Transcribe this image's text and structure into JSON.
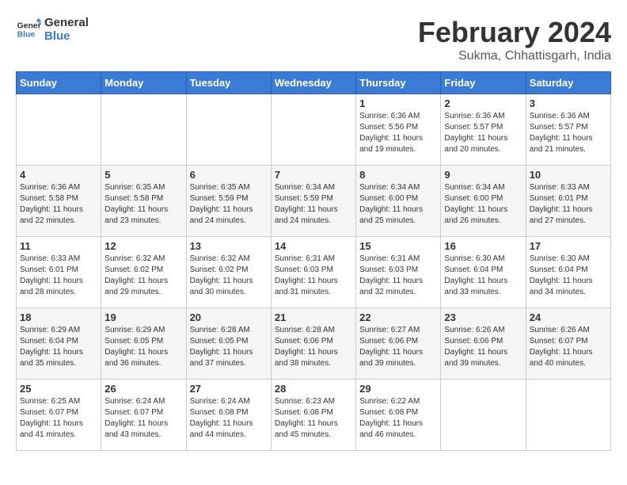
{
  "logo": {
    "line1": "General",
    "line2": "Blue"
  },
  "title": "February 2024",
  "subtitle": "Sukma, Chhattisgarh, India",
  "days_of_week": [
    "Sunday",
    "Monday",
    "Tuesday",
    "Wednesday",
    "Thursday",
    "Friday",
    "Saturday"
  ],
  "weeks": [
    [
      {
        "day": "",
        "info": ""
      },
      {
        "day": "",
        "info": ""
      },
      {
        "day": "",
        "info": ""
      },
      {
        "day": "",
        "info": ""
      },
      {
        "day": "1",
        "info": "Sunrise: 6:36 AM\nSunset: 5:56 PM\nDaylight: 11 hours\nand 19 minutes."
      },
      {
        "day": "2",
        "info": "Sunrise: 6:36 AM\nSunset: 5:57 PM\nDaylight: 11 hours\nand 20 minutes."
      },
      {
        "day": "3",
        "info": "Sunrise: 6:36 AM\nSunset: 5:57 PM\nDaylight: 11 hours\nand 21 minutes."
      }
    ],
    [
      {
        "day": "4",
        "info": "Sunrise: 6:36 AM\nSunset: 5:58 PM\nDaylight: 11 hours\nand 22 minutes."
      },
      {
        "day": "5",
        "info": "Sunrise: 6:35 AM\nSunset: 5:58 PM\nDaylight: 11 hours\nand 23 minutes."
      },
      {
        "day": "6",
        "info": "Sunrise: 6:35 AM\nSunset: 5:59 PM\nDaylight: 11 hours\nand 24 minutes."
      },
      {
        "day": "7",
        "info": "Sunrise: 6:34 AM\nSunset: 5:59 PM\nDaylight: 11 hours\nand 24 minutes."
      },
      {
        "day": "8",
        "info": "Sunrise: 6:34 AM\nSunset: 6:00 PM\nDaylight: 11 hours\nand 25 minutes."
      },
      {
        "day": "9",
        "info": "Sunrise: 6:34 AM\nSunset: 6:00 PM\nDaylight: 11 hours\nand 26 minutes."
      },
      {
        "day": "10",
        "info": "Sunrise: 6:33 AM\nSunset: 6:01 PM\nDaylight: 11 hours\nand 27 minutes."
      }
    ],
    [
      {
        "day": "11",
        "info": "Sunrise: 6:33 AM\nSunset: 6:01 PM\nDaylight: 11 hours\nand 28 minutes."
      },
      {
        "day": "12",
        "info": "Sunrise: 6:32 AM\nSunset: 6:02 PM\nDaylight: 11 hours\nand 29 minutes."
      },
      {
        "day": "13",
        "info": "Sunrise: 6:32 AM\nSunset: 6:02 PM\nDaylight: 11 hours\nand 30 minutes."
      },
      {
        "day": "14",
        "info": "Sunrise: 6:31 AM\nSunset: 6:03 PM\nDaylight: 11 hours\nand 31 minutes."
      },
      {
        "day": "15",
        "info": "Sunrise: 6:31 AM\nSunset: 6:03 PM\nDaylight: 11 hours\nand 32 minutes."
      },
      {
        "day": "16",
        "info": "Sunrise: 6:30 AM\nSunset: 6:04 PM\nDaylight: 11 hours\nand 33 minutes."
      },
      {
        "day": "17",
        "info": "Sunrise: 6:30 AM\nSunset: 6:04 PM\nDaylight: 11 hours\nand 34 minutes."
      }
    ],
    [
      {
        "day": "18",
        "info": "Sunrise: 6:29 AM\nSunset: 6:04 PM\nDaylight: 11 hours\nand 35 minutes."
      },
      {
        "day": "19",
        "info": "Sunrise: 6:29 AM\nSunset: 6:05 PM\nDaylight: 11 hours\nand 36 minutes."
      },
      {
        "day": "20",
        "info": "Sunrise: 6:28 AM\nSunset: 6:05 PM\nDaylight: 11 hours\nand 37 minutes."
      },
      {
        "day": "21",
        "info": "Sunrise: 6:28 AM\nSunset: 6:06 PM\nDaylight: 11 hours\nand 38 minutes."
      },
      {
        "day": "22",
        "info": "Sunrise: 6:27 AM\nSunset: 6:06 PM\nDaylight: 11 hours\nand 39 minutes."
      },
      {
        "day": "23",
        "info": "Sunrise: 6:26 AM\nSunset: 6:06 PM\nDaylight: 11 hours\nand 39 minutes."
      },
      {
        "day": "24",
        "info": "Sunrise: 6:26 AM\nSunset: 6:07 PM\nDaylight: 11 hours\nand 40 minutes."
      }
    ],
    [
      {
        "day": "25",
        "info": "Sunrise: 6:25 AM\nSunset: 6:07 PM\nDaylight: 11 hours\nand 41 minutes."
      },
      {
        "day": "26",
        "info": "Sunrise: 6:24 AM\nSunset: 6:07 PM\nDaylight: 11 hours\nand 43 minutes."
      },
      {
        "day": "27",
        "info": "Sunrise: 6:24 AM\nSunset: 6:08 PM\nDaylight: 11 hours\nand 44 minutes."
      },
      {
        "day": "28",
        "info": "Sunrise: 6:23 AM\nSunset: 6:08 PM\nDaylight: 11 hours\nand 45 minutes."
      },
      {
        "day": "29",
        "info": "Sunrise: 6:22 AM\nSunset: 6:08 PM\nDaylight: 11 hours\nand 46 minutes."
      },
      {
        "day": "",
        "info": ""
      },
      {
        "day": "",
        "info": ""
      }
    ]
  ]
}
